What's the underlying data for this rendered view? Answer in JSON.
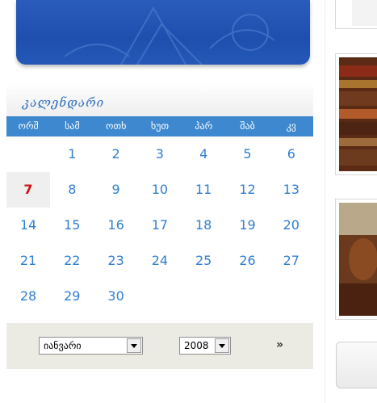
{
  "calendar": {
    "title": "კალენდარი",
    "weekdays": [
      "ორშ",
      "სამ",
      "ოთხ",
      "ხუთ",
      "პარ",
      "შაბ",
      "კვ"
    ],
    "days": [
      {
        "label": "1"
      },
      {
        "label": "2"
      },
      {
        "label": "3"
      },
      {
        "label": "4"
      },
      {
        "label": "5"
      },
      {
        "label": "6"
      },
      {
        "label": "7"
      },
      {
        "label": "8"
      },
      {
        "label": "9"
      },
      {
        "label": "10"
      },
      {
        "label": "11"
      },
      {
        "label": "12"
      },
      {
        "label": "13"
      },
      {
        "label": "14"
      },
      {
        "label": "15"
      },
      {
        "label": "16"
      },
      {
        "label": "17"
      },
      {
        "label": "18"
      },
      {
        "label": "19"
      },
      {
        "label": "20"
      },
      {
        "label": "21"
      },
      {
        "label": "22"
      },
      {
        "label": "23"
      },
      {
        "label": "24"
      },
      {
        "label": "25"
      },
      {
        "label": "26"
      },
      {
        "label": "27"
      },
      {
        "label": "28"
      },
      {
        "label": "29"
      },
      {
        "label": "30"
      }
    ],
    "first_weekday_index": 1,
    "today": "7",
    "month_select": "იანვარი",
    "year_select": "2008",
    "go_icon": "double-arrow-icon",
    "colors": {
      "header_bg": "#3d88cf",
      "day_text": "#2f7fd0",
      "today_text": "#cc1111",
      "footer_bg": "#ecebe3"
    }
  }
}
